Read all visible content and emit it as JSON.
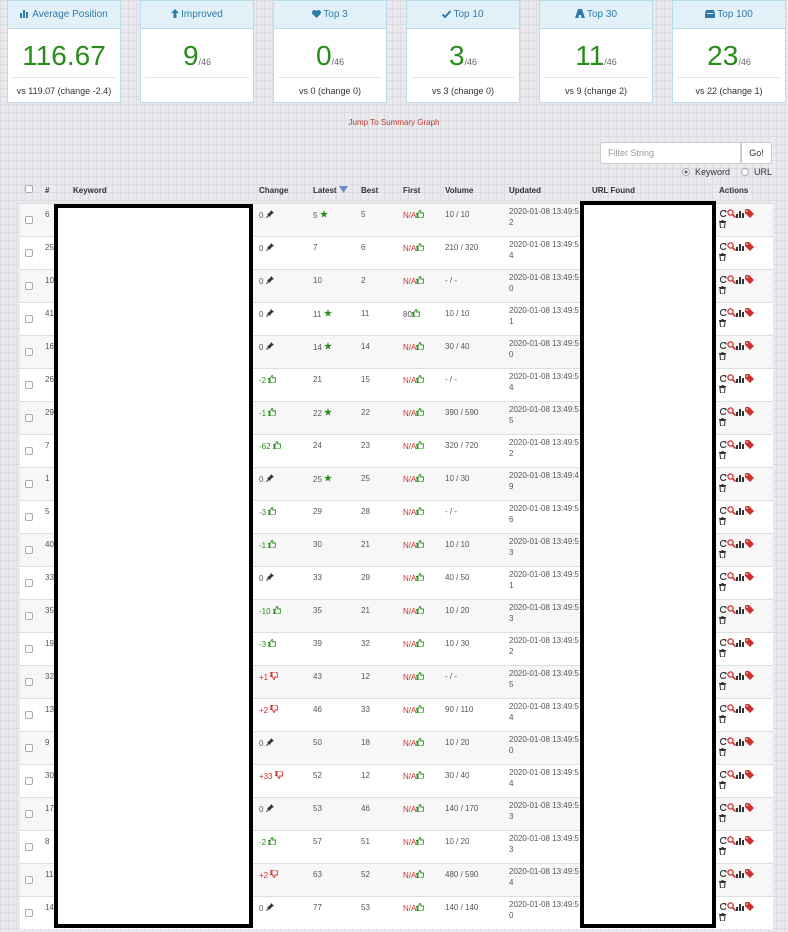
{
  "cards": [
    {
      "title": "Average Position",
      "icon": "bar-chart-icon",
      "value": "116.67",
      "denominator": "",
      "footer": "vs 119.07 (change -2.4)"
    },
    {
      "title": "Improved",
      "icon": "arrow-up-icon",
      "value": "9",
      "denominator": "/46",
      "footer": ""
    },
    {
      "title": "Top 3",
      "icon": "heart-icon",
      "value": "0",
      "denominator": "/46",
      "footer": "vs 0 (change 0)"
    },
    {
      "title": "Top 10",
      "icon": "check-icon",
      "value": "3",
      "denominator": "/46",
      "footer": "vs 3 (change 0)"
    },
    {
      "title": "Top 30",
      "icon": "road-icon",
      "value": "11",
      "denominator": "/46",
      "footer": "vs 9 (change 2)"
    },
    {
      "title": "Top 100",
      "icon": "inbox-icon",
      "value": "23",
      "denominator": "/46",
      "footer": "vs 22 (change 1)"
    }
  ],
  "jump_link": "Jump To Summary Graph",
  "filter": {
    "placeholder": "Filter String",
    "go_label": "Go!",
    "radio_keyword": "Keyword",
    "radio_url": "URL",
    "selected": "Keyword"
  },
  "table": {
    "headers": {
      "num": "#",
      "keyword": "Keyword",
      "change": "Change",
      "latest": "Latest",
      "best": "Best",
      "first": "First",
      "volume": "Volume",
      "updated": "Updated",
      "url": "URL Found",
      "actions": "Actions"
    },
    "rows": [
      {
        "num": "6",
        "change": "0",
        "change_icon": "pin",
        "latest": "5",
        "star": true,
        "best": "5",
        "first": "N/A",
        "first_icon": "up",
        "volume": "10 / 10",
        "updated": "2020-01-08 13:49:5",
        "updated2": "2"
      },
      {
        "num": "25",
        "change": "0",
        "change_icon": "pin",
        "latest": "7",
        "star": false,
        "best": "6",
        "first": "N/A",
        "first_icon": "up",
        "volume": "210 / 320",
        "updated": "2020-01-08 13:49:5",
        "updated2": "4"
      },
      {
        "num": "10",
        "change": "0",
        "change_icon": "pin",
        "latest": "10",
        "star": false,
        "best": "2",
        "first": "N/A",
        "first_icon": "up",
        "volume": "- / -",
        "updated": "2020-01-08 13:49:5",
        "updated2": "0"
      },
      {
        "num": "41",
        "change": "0",
        "change_icon": "pin",
        "latest": "11",
        "star": true,
        "best": "11",
        "first": "80",
        "first_icon": "up",
        "volume": "10 / 10",
        "updated": "2020-01-08 13:49:5",
        "updated2": "1"
      },
      {
        "num": "16",
        "change": "0",
        "change_icon": "pin",
        "latest": "14",
        "star": true,
        "best": "14",
        "first": "N/A",
        "first_icon": "up",
        "volume": "30 / 40",
        "updated": "2020-01-08 13:49:5",
        "updated2": "0"
      },
      {
        "num": "26",
        "change": "-2",
        "change_icon": "up",
        "latest": "21",
        "star": false,
        "best": "15",
        "first": "N/A",
        "first_icon": "up",
        "volume": "- / -",
        "updated": "2020-01-08 13:49:5",
        "updated2": "4"
      },
      {
        "num": "29",
        "change": "-1",
        "change_icon": "up",
        "latest": "22",
        "star": true,
        "best": "22",
        "first": "N/A",
        "first_icon": "up",
        "volume": "390 / 590",
        "updated": "2020-01-08 13:49:5",
        "updated2": "5"
      },
      {
        "num": "7",
        "change": "-62",
        "change_icon": "up",
        "latest": "24",
        "star": false,
        "best": "23",
        "first": "N/A",
        "first_icon": "up",
        "volume": "320 / 720",
        "updated": "2020-01-08 13:49:5",
        "updated2": "2"
      },
      {
        "num": "1",
        "change": "0",
        "change_icon": "pin",
        "latest": "25",
        "star": true,
        "best": "25",
        "first": "N/A",
        "first_icon": "up",
        "volume": "10 / 30",
        "updated": "2020-01-08 13:49:4",
        "updated2": "9"
      },
      {
        "num": "5",
        "change": "-3",
        "change_icon": "up",
        "latest": "29",
        "star": false,
        "best": "28",
        "first": "N/A",
        "first_icon": "up",
        "volume": "- / -",
        "updated": "2020-01-08 13:49:5",
        "updated2": "6"
      },
      {
        "num": "40",
        "change": "-1",
        "change_icon": "up",
        "latest": "30",
        "star": false,
        "best": "21",
        "first": "N/A",
        "first_icon": "up",
        "volume": "10 / 10",
        "updated": "2020-01-08 13:49:5",
        "updated2": "3"
      },
      {
        "num": "33",
        "change": "0",
        "change_icon": "pin",
        "latest": "33",
        "star": false,
        "best": "29",
        "first": "N/A",
        "first_icon": "up",
        "volume": "40 / 50",
        "updated": "2020-01-08 13:49:5",
        "updated2": "1"
      },
      {
        "num": "35",
        "change": "-10",
        "change_icon": "up",
        "latest": "35",
        "star": false,
        "best": "21",
        "first": "N/A",
        "first_icon": "up",
        "volume": "10 / 20",
        "updated": "2020-01-08 13:49:5",
        "updated2": "3"
      },
      {
        "num": "19",
        "change": "-3",
        "change_icon": "up",
        "latest": "39",
        "star": false,
        "best": "32",
        "first": "N/A",
        "first_icon": "up",
        "volume": "10 / 30",
        "updated": "2020-01-08 13:49:5",
        "updated2": "2"
      },
      {
        "num": "32",
        "change": "+1",
        "change_icon": "down",
        "latest": "43",
        "star": false,
        "best": "12",
        "first": "N/A",
        "first_icon": "up",
        "volume": "- / -",
        "updated": "2020-01-08 13:49:5",
        "updated2": "5"
      },
      {
        "num": "13",
        "change": "+2",
        "change_icon": "down",
        "latest": "46",
        "star": false,
        "best": "33",
        "first": "N/A",
        "first_icon": "up",
        "volume": "90 / 110",
        "updated": "2020-01-08 13:49:5",
        "updated2": "4"
      },
      {
        "num": "9",
        "change": "0",
        "change_icon": "pin",
        "latest": "50",
        "star": false,
        "best": "18",
        "first": "N/A",
        "first_icon": "up",
        "volume": "10 / 20",
        "updated": "2020-01-08 13:49:5",
        "updated2": "0"
      },
      {
        "num": "30",
        "change": "+33",
        "change_icon": "down",
        "latest": "52",
        "star": false,
        "best": "12",
        "first": "N/A",
        "first_icon": "up",
        "volume": "30 / 40",
        "updated": "2020-01-08 13:49:5",
        "updated2": "4"
      },
      {
        "num": "17",
        "change": "0",
        "change_icon": "pin",
        "latest": "53",
        "star": false,
        "best": "46",
        "first": "N/A",
        "first_icon": "up",
        "volume": "140 / 170",
        "updated": "2020-01-08 13:49:5",
        "updated2": "3"
      },
      {
        "num": "8",
        "change": "-2",
        "change_icon": "up",
        "latest": "57",
        "star": false,
        "best": "51",
        "first": "N/A",
        "first_icon": "up",
        "volume": "10 / 20",
        "updated": "2020-01-08 13:49:5",
        "updated2": "3"
      },
      {
        "num": "11",
        "change": "+2",
        "change_icon": "down",
        "latest": "63",
        "star": false,
        "best": "52",
        "first": "N/A",
        "first_icon": "up",
        "volume": "480 / 590",
        "updated": "2020-01-08 13:49:5",
        "updated2": "4"
      },
      {
        "num": "14",
        "change": "0",
        "change_icon": "pin",
        "latest": "77",
        "star": false,
        "best": "53",
        "first": "N/A",
        "first_icon": "up",
        "volume": "140 / 140",
        "updated": "2020-01-08 13:49:5",
        "updated2": "0"
      }
    ]
  },
  "colors": {
    "accent": "#2e7aa8",
    "positive": "#2a8c1c",
    "negative": "#d0312d",
    "header_bg": "#e2f1f8"
  }
}
